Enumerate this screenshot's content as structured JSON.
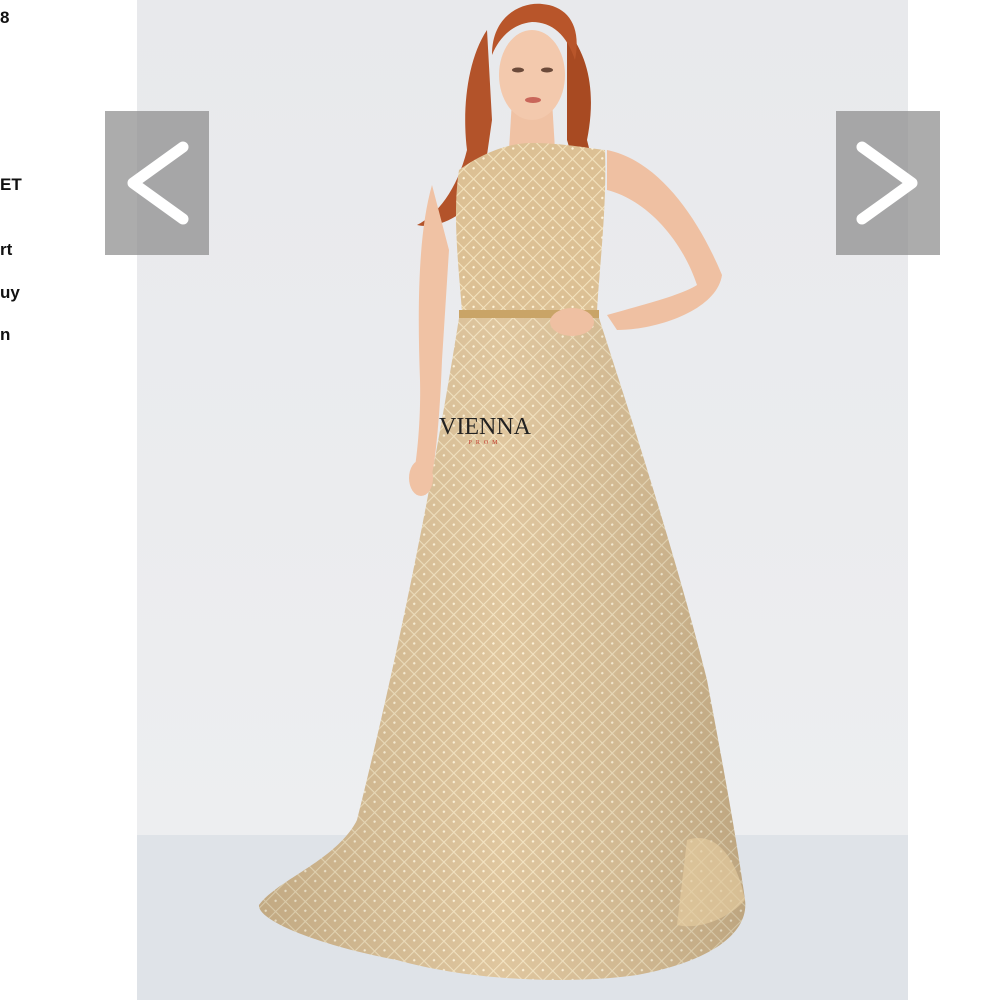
{
  "sidebar": {
    "fragments": [
      "8",
      "ET",
      "rt",
      "uy",
      "n"
    ]
  },
  "product_image": {
    "brand": "VIENNA",
    "brand_sub": "PROM",
    "dress_color": "#d8b98a",
    "background_color": "#e9eaec"
  },
  "carousel": {
    "prev_icon": "chevron-left-icon",
    "next_icon": "chevron-right-icon"
  }
}
